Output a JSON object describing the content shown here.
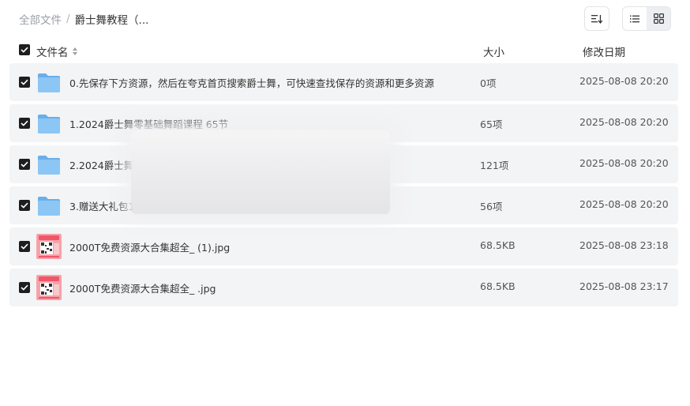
{
  "breadcrumb": {
    "root": "全部文件",
    "separator": "/",
    "current": "爵士舞教程（..."
  },
  "toolbar": {
    "sort_icon": "sort-list-icon",
    "view_list_icon": "list-view-icon",
    "view_grid_icon": "grid-view-icon",
    "active_view": "list"
  },
  "table": {
    "columns": {
      "name": "文件名",
      "size": "大小",
      "date": "修改日期"
    },
    "rows": [
      {
        "type": "folder",
        "name": "0.先保存下方资源，然后在夸克首页搜索爵士舞，可快速查找保存的资源和更多资源",
        "size": "0项",
        "date": "2025-08-08 20:20",
        "checked": true
      },
      {
        "type": "folder",
        "name": "1.2024爵士舞零基础舞蹈课程 65节",
        "size": "65项",
        "date": "2025-08-08 20:20",
        "checked": true
      },
      {
        "type": "folder",
        "name": "2.2024爵士舞",
        "size": "121项",
        "date": "2025-08-08 20:20",
        "checked": true
      },
      {
        "type": "folder",
        "name": "3.赠送大礼包1",
        "size": "56项",
        "date": "2025-08-08 20:20",
        "checked": true
      },
      {
        "type": "image",
        "name": "2000T免费资源大合集超全_ (1).jpg",
        "size": "68.5KB",
        "date": "2025-08-08 23:18",
        "checked": true
      },
      {
        "type": "image",
        "name": "2000T免费资源大合集超全_ .jpg",
        "size": "68.5KB",
        "date": "2025-08-08 23:17",
        "checked": true
      }
    ]
  },
  "colors": {
    "row_background": "#f3f4f5",
    "checkbox": "#1e1e1e",
    "folder": "#7ab8f0",
    "thumbnail_accent": "#f0566a"
  }
}
